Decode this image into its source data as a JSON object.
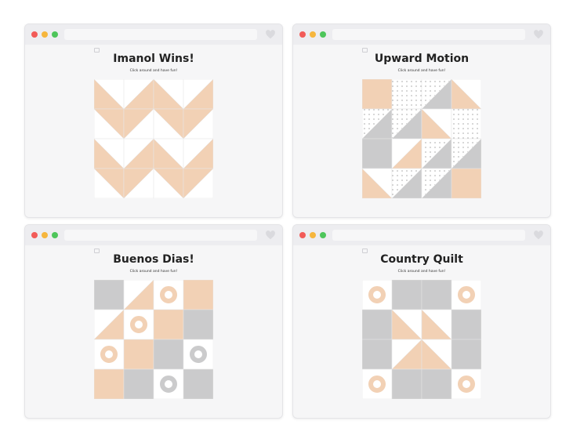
{
  "colors": {
    "peach": "#f2d1b5",
    "gray": "#cbcbcc",
    "white": "#ffffff",
    "red": "#f25b58",
    "yellow": "#f6b63d",
    "green": "#4dc55a"
  },
  "windows": [
    {
      "title": "Imanol Wins!",
      "subtitle": "Click around and have fun!",
      "pattern": "triangles"
    },
    {
      "title": "Upward Motion",
      "subtitle": "Click around and have fun!",
      "pattern": "diagonal"
    },
    {
      "title": "Buenos Dias!",
      "subtitle": "Click around and have fun!",
      "pattern": "donuts"
    },
    {
      "title": "Country Quilt",
      "subtitle": "Click around and have fun!",
      "pattern": "country"
    }
  ]
}
